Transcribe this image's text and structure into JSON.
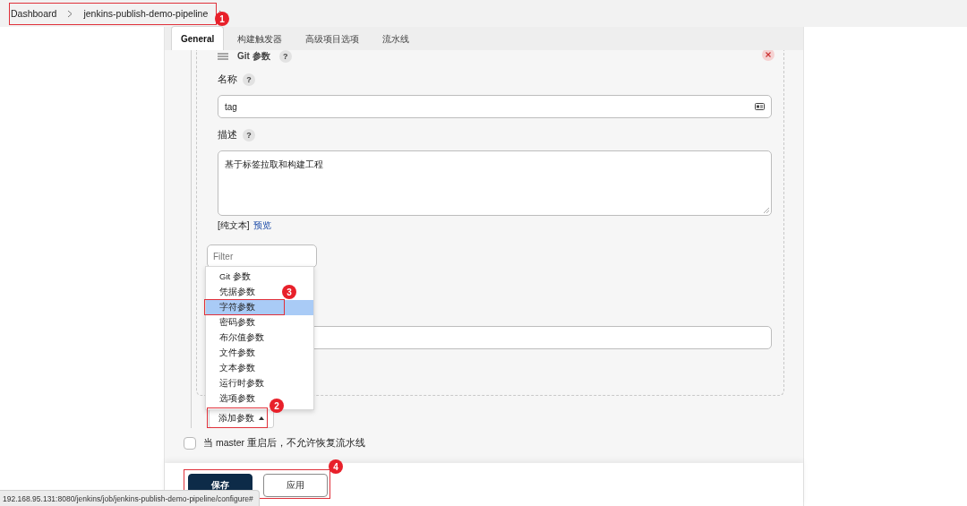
{
  "breadcrumb": [
    {
      "label": "Dashboard"
    },
    {
      "label": "jenkins-publish-demo-pipeline"
    }
  ],
  "tabs": [
    {
      "label": "General",
      "selected": true
    },
    {
      "label": "构建触发器",
      "selected": false
    },
    {
      "label": "高级项目选项",
      "selected": false
    },
    {
      "label": "流水线",
      "selected": false
    }
  ],
  "parameter": {
    "title": "Git 参数",
    "title_help": "?",
    "fields": [
      {
        "kind": "input",
        "label": "名称",
        "help": "?",
        "value": "tag"
      },
      {
        "kind": "textarea",
        "label": "描述",
        "help": "?",
        "value": "基于标签拉取和构建工程"
      }
    ],
    "format_label": "[纯文本]",
    "preview_link": "预览"
  },
  "filter": {
    "placeholder": "Filter"
  },
  "menu": [
    {
      "label": "Git 参数",
      "selected": false
    },
    {
      "label": "凭据参数",
      "selected": false
    },
    {
      "label": "字符参数",
      "selected": true
    },
    {
      "label": "密码参数",
      "selected": false
    },
    {
      "label": "布尔值参数",
      "selected": false
    },
    {
      "label": "文件参数",
      "selected": false
    },
    {
      "label": "文本参数",
      "selected": false
    },
    {
      "label": "运行时参数",
      "selected": false
    },
    {
      "label": "选项参数",
      "selected": false
    }
  ],
  "add_button": "添加参数",
  "options": [
    {
      "label": "当 master 重启后，不允许恢复流水线",
      "checked": false
    }
  ],
  "buttons": [
    {
      "kind": "primary",
      "label": "保存"
    },
    {
      "kind": "secondary",
      "label": "应用"
    }
  ],
  "status_url": "192.168.95.131:8080/jenkins/job/jenkins-publish-demo-pipeline/configure#",
  "annotations": [
    "1",
    "2",
    "3",
    "4"
  ]
}
